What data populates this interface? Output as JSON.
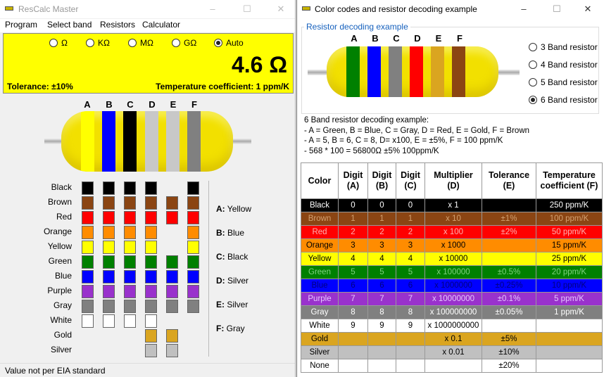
{
  "left_window": {
    "title": "ResCalc Master",
    "menu": [
      "Program",
      "Select band",
      "Resistors",
      "Calculator"
    ],
    "units": [
      {
        "label": "Ω",
        "selected": false
      },
      {
        "label": "KΩ",
        "selected": false
      },
      {
        "label": "MΩ",
        "selected": false
      },
      {
        "label": "GΩ",
        "selected": false
      },
      {
        "label": "Auto",
        "selected": true
      }
    ],
    "value": "4.6 Ω",
    "tolerance": "Tolerance: ±10%",
    "temperature": "Temperature coefficient: 1 ppm/K",
    "band_letters": [
      "A",
      "B",
      "C",
      "D",
      "E",
      "F"
    ],
    "band_colors": [
      "#ffff00",
      "#0000ff",
      "#000000",
      "#c8c8c8",
      "#c8c8c8",
      "#808080"
    ],
    "color_rows": [
      "Black",
      "Brown",
      "Red",
      "Orange",
      "Yellow",
      "Green",
      "Blue",
      "Purple",
      "Gray",
      "White",
      "Gold",
      "Silver"
    ],
    "assignments": [
      {
        "letter": "A:",
        "color": "Yellow"
      },
      {
        "letter": "B:",
        "color": "Blue"
      },
      {
        "letter": "C:",
        "color": "Black"
      },
      {
        "letter": "D:",
        "color": "Silver"
      },
      {
        "letter": "E:",
        "color": "Silver"
      },
      {
        "letter": "F:",
        "color": "Gray"
      }
    ],
    "status": "Value not per EIA standard"
  },
  "right_window": {
    "title": "Color codes and resistor decoding example",
    "group_title": "Resistor decoding example",
    "band_letters": [
      "A",
      "B",
      "C",
      "D",
      "E",
      "F"
    ],
    "band_colors": [
      "#008000",
      "#0000ff",
      "#808080",
      "#ff0000",
      "#daa520",
      "#8b4513"
    ],
    "band_options": [
      {
        "label": "3 Band resistor",
        "selected": false
      },
      {
        "label": "4 Band resistor",
        "selected": false
      },
      {
        "label": "5 Band resistor",
        "selected": false
      },
      {
        "label": "6 Band resistor",
        "selected": true
      }
    ],
    "example_lines": [
      "6 Band resistor decoding example:",
      "- A = Green, B = Blue, C = Gray, D = Red, E = Gold, F = Brown",
      "- A = 5, B = 6, C = 8, D= x100, E = ±5%, F = 100 ppm/K",
      "- 568 * 100 = 56800Ω ±5% 100ppm/K"
    ],
    "table": {
      "headers": [
        "Color",
        "Digit (A)",
        "Digit (B)",
        "Digit (C)",
        "Multiplier (D)",
        "Tolerance (E)",
        "Temperature coefficient (F)"
      ],
      "rows": [
        {
          "color": "Black",
          "bg": "#000000",
          "fg": "#ffffff",
          "cells": [
            "0",
            "0",
            "0",
            "x 1",
            "",
            "250 ppm/K"
          ]
        },
        {
          "color": "Brown",
          "bg": "#8b4513",
          "fg": "#d2a070",
          "cells": [
            "1",
            "1",
            "1",
            "x 10",
            "±1%",
            "100 ppm/K"
          ]
        },
        {
          "color": "Red",
          "bg": "#ff0000",
          "fg": "#ffb0b0",
          "cells": [
            "2",
            "2",
            "2",
            "x 100",
            "±2%",
            "50 ppm/K"
          ]
        },
        {
          "color": "Orange",
          "bg": "#ff8c00",
          "fg": "#000000",
          "cells": [
            "3",
            "3",
            "3",
            "x 1000",
            "",
            "15 ppm/K"
          ]
        },
        {
          "color": "Yellow",
          "bg": "#ffff00",
          "fg": "#000000",
          "cells": [
            "4",
            "4",
            "4",
            "x 10000",
            "",
            "25 ppm/K"
          ]
        },
        {
          "color": "Green",
          "bg": "#008000",
          "fg": "#80d080",
          "cells": [
            "5",
            "5",
            "5",
            "x 100000",
            "±0.5%",
            "20 ppm/K"
          ]
        },
        {
          "color": "Blue",
          "bg": "#0000ff",
          "fg": "#000080",
          "cells": [
            "6",
            "6",
            "6",
            "x 1000000",
            "±0.25%",
            "10 ppm/K"
          ]
        },
        {
          "color": "Purple",
          "bg": "#9932cc",
          "fg": "#e6c8ff",
          "cells": [
            "7",
            "7",
            "7",
            "x 10000000",
            "±0.1%",
            "5 ppm/K"
          ]
        },
        {
          "color": "Gray",
          "bg": "#808080",
          "fg": "#ffffff",
          "cells": [
            "8",
            "8",
            "8",
            "x 100000000",
            "±0.05%",
            "1 ppm/K"
          ]
        },
        {
          "color": "White",
          "bg": "#ffffff",
          "fg": "#000000",
          "cells": [
            "9",
            "9",
            "9",
            "x 1000000000",
            "",
            ""
          ]
        },
        {
          "color": "Gold",
          "bg": "#daa520",
          "fg": "#000000",
          "cells": [
            "",
            "",
            "",
            "x 0.1",
            "±5%",
            ""
          ]
        },
        {
          "color": "Silver",
          "bg": "#c0c0c0",
          "fg": "#000000",
          "cells": [
            "",
            "",
            "",
            "x 0.01",
            "±10%",
            ""
          ]
        },
        {
          "color": "None",
          "bg": "#ffffff",
          "fg": "#000000",
          "cells": [
            "",
            "",
            "",
            "",
            "±20%",
            ""
          ]
        }
      ]
    }
  },
  "palette": {
    "Black": "#000000",
    "Brown": "#8b4513",
    "Red": "#ff0000",
    "Orange": "#ff8c00",
    "Yellow": "#ffff00",
    "Green": "#008000",
    "Blue": "#0000ff",
    "Purple": "#9932cc",
    "Gray": "#808080",
    "White": "#ffffff",
    "Gold": "#daa520",
    "Silver": "#c0c0c0"
  },
  "band_availability": {
    "digit": [
      "Black",
      "Brown",
      "Red",
      "Orange",
      "Yellow",
      "Green",
      "Blue",
      "Purple",
      "Gray",
      "White"
    ],
    "multiplier": [
      "Black",
      "Brown",
      "Red",
      "Orange",
      "Yellow",
      "Green",
      "Blue",
      "Purple",
      "Gray",
      "White",
      "Gold",
      "Silver"
    ],
    "tolerance": [
      "Brown",
      "Red",
      "Green",
      "Blue",
      "Purple",
      "Gray",
      "Gold",
      "Silver"
    ],
    "tempco": [
      "Black",
      "Brown",
      "Red",
      "Orange",
      "Yellow",
      "Green",
      "Blue",
      "Purple",
      "Gray"
    ]
  }
}
